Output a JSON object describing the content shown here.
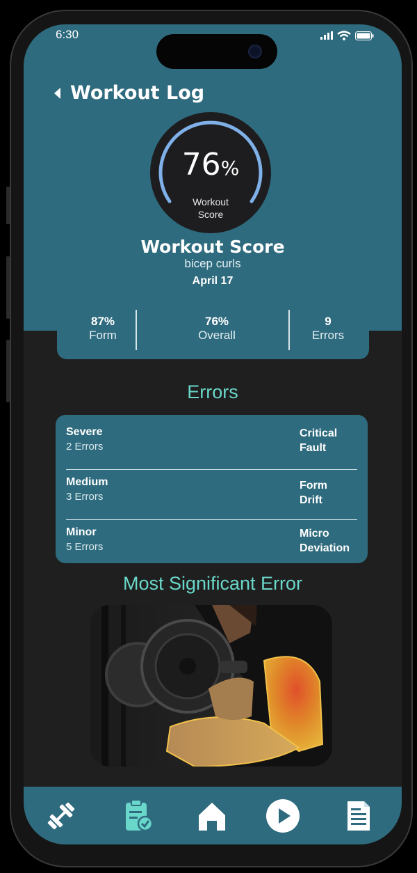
{
  "status_bar": {
    "time": "6:30"
  },
  "header": {
    "title": "Workout Log"
  },
  "score": {
    "percent": "76",
    "percent_symbol": "%",
    "ring_label_line1": "Workout",
    "ring_label_line2": "Score",
    "title": "Workout Score",
    "exercise": "bicep curls",
    "date": "April 17"
  },
  "stats": [
    {
      "value": "87%",
      "label": "Form"
    },
    {
      "value": "76%",
      "label": "Overall"
    },
    {
      "value": "9",
      "label": "Errors"
    }
  ],
  "errors_section": {
    "title": "Errors",
    "rows": [
      {
        "level": "Severe",
        "count": "2 Errors",
        "type_line1": "Critical",
        "type_line2": "Fault"
      },
      {
        "level": "Medium",
        "count": "3 Errors",
        "type_line1": "Form",
        "type_line2": "Drift"
      },
      {
        "level": "Minor",
        "count": "5 Errors",
        "type_line1": "Micro",
        "type_line2": "Deviation"
      }
    ]
  },
  "most_significant": {
    "title": "Most Significant Error"
  },
  "nav": {
    "items": [
      "workouts-icon",
      "log-icon",
      "home-icon",
      "play-icon",
      "report-icon"
    ]
  },
  "colors": {
    "teal": "#2f6b7e",
    "accent": "#69d7c9",
    "ring": "#7fb0e8",
    "dark": "#1f1f1f"
  }
}
